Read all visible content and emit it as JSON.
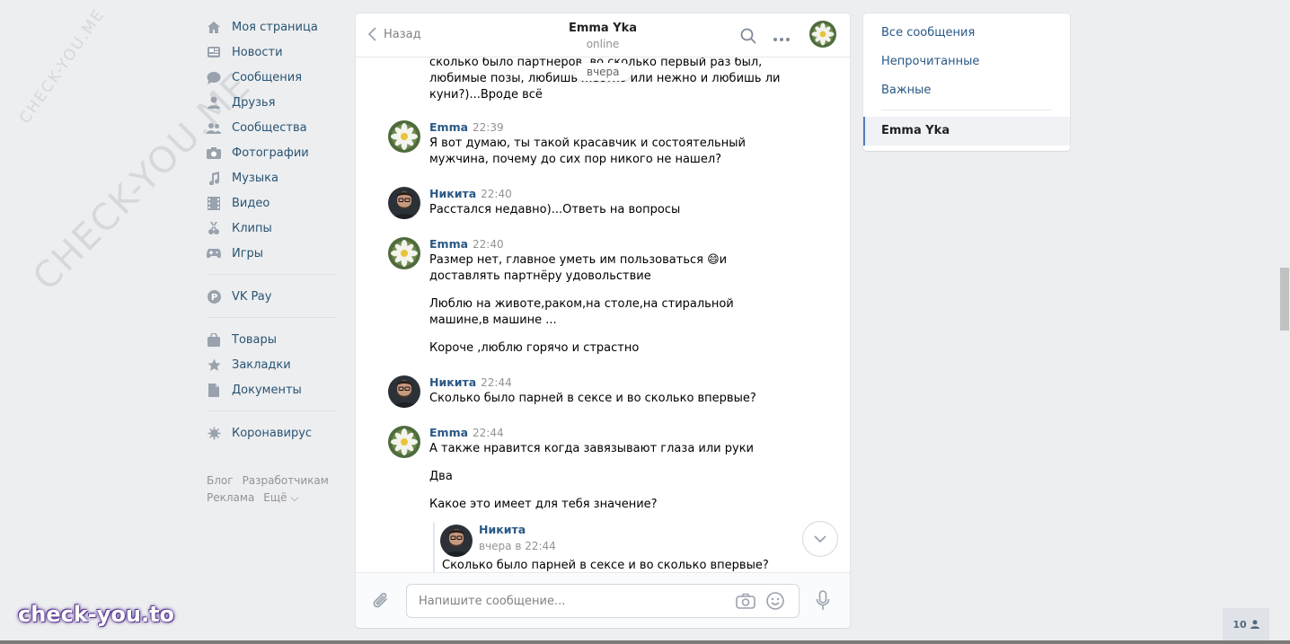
{
  "watermark": {
    "small": "CHECK-YOU.ME",
    "large": "CHECK-YOU.ME",
    "brand": "check-you.to"
  },
  "nav": {
    "main": [
      {
        "label": "Моя страница",
        "icon": "home-icon"
      },
      {
        "label": "Новости",
        "icon": "news-icon"
      },
      {
        "label": "Сообщения",
        "icon": "messages-icon"
      },
      {
        "label": "Друзья",
        "icon": "friends-icon"
      },
      {
        "label": "Сообщества",
        "icon": "groups-icon"
      },
      {
        "label": "Фотографии",
        "icon": "camera-icon"
      },
      {
        "label": "Музыка",
        "icon": "music-icon"
      },
      {
        "label": "Видео",
        "icon": "video-icon"
      },
      {
        "label": "Клипы",
        "icon": "clips-icon"
      },
      {
        "label": "Игры",
        "icon": "gamepad-icon"
      }
    ],
    "pay": {
      "label": "VK Pay",
      "icon": "vkpay-icon"
    },
    "extra": [
      {
        "label": "Товары",
        "icon": "bag-icon"
      },
      {
        "label": "Закладки",
        "icon": "star-icon"
      },
      {
        "label": "Документы",
        "icon": "document-icon"
      }
    ],
    "corona": {
      "label": "Коронавирус",
      "icon": "virus-icon"
    },
    "footer": {
      "blog": "Блог",
      "dev": "Разработчикам",
      "ads": "Реклама",
      "more": "Ещё ⌵"
    }
  },
  "chat": {
    "back_label": "Назад",
    "peer_name": "Emma Yka",
    "peer_status": "online",
    "date_pill": "вчера",
    "partial_text": "сколько было партнёров, во сколько первый раз был, любимые позы, любишь жёстко или нежно и любишь ли куни?)...Вроде всё",
    "messages": [
      {
        "author": "Emma",
        "time": "22:39",
        "paragraphs": [
          "Я вот думаю, ты такой красавчик и состоятельный мужчина, почему до сих пор никого не нашел?"
        ]
      },
      {
        "author": "Никита",
        "time": "22:40",
        "paragraphs": [
          "Расстался недавно)...Ответь на вопросы"
        ]
      },
      {
        "author": "Emma",
        "time": "22:40",
        "paragraphs": [
          "Размер нет, главное уметь им пользоваться 😄и доставлять партнёру удовольствие",
          "Люблю на животе,раком,на столе,на стиральной машине,в машине ...",
          "Короче ,люблю горячо и страстно"
        ]
      },
      {
        "author": "Никита",
        "time": "22:44",
        "paragraphs": [
          "Сколько было парней в сексе и во сколько впервые?"
        ]
      },
      {
        "author": "Emma",
        "time": "22:44",
        "paragraphs": [
          "А также нравится когда завязывают глаза или руки",
          "Два",
          "Какое это имеет для тебя значение?"
        ]
      }
    ],
    "forwarded": {
      "author": "Никита",
      "date": "вчера в 22:44",
      "text": "Сколько было парней в сексе и во сколько впервые?"
    },
    "composer_placeholder": "Напишите сообщение..."
  },
  "side": {
    "all": "Все сообщения",
    "unread": "Непрочитанные",
    "important": "Важные",
    "active": "Emma Yka"
  },
  "online_count": "10"
}
